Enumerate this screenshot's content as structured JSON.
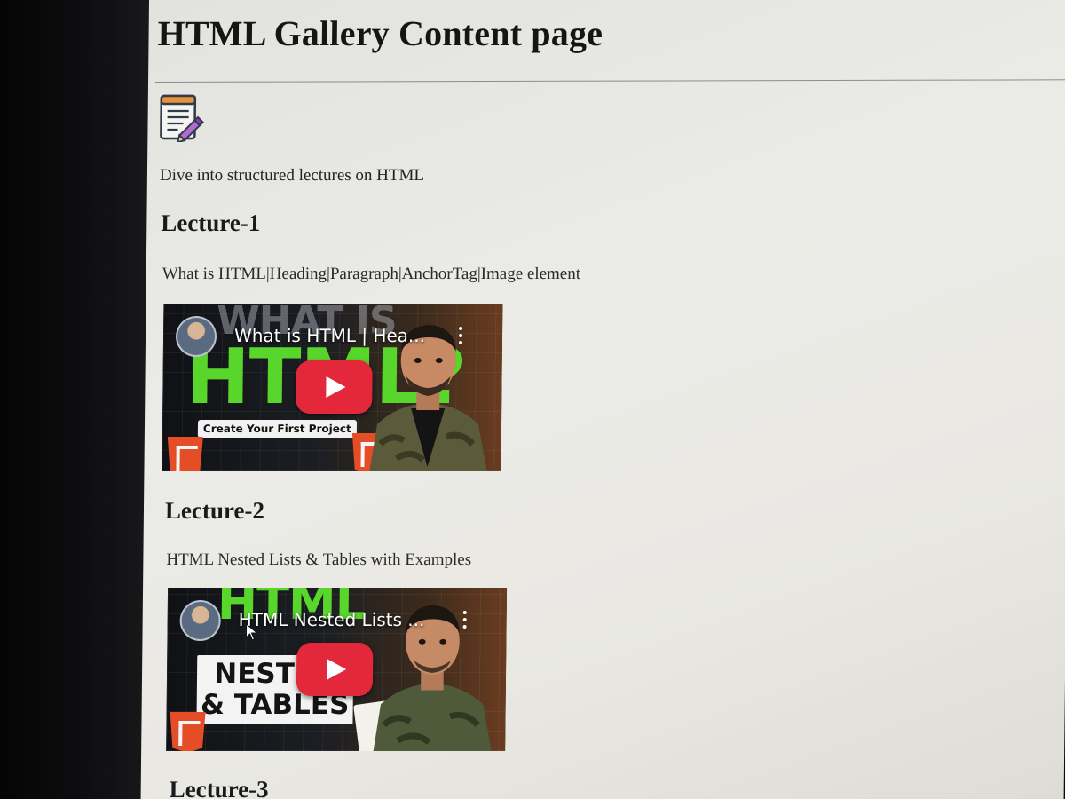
{
  "page": {
    "title": "HTML Gallery Content page",
    "tagline": "Dive into structured lectures on HTML",
    "header_icon": "notepad-pencil-icon"
  },
  "lectures": [
    {
      "heading": "Lecture-1",
      "description": "What is HTML|Heading|Paragraph|AnchorTag|Image element",
      "video": {
        "title": "What is HTML | Hea...",
        "thumbnail_ghost_text": "WHAT IS",
        "thumbnail_big_text": "HTML?",
        "thumbnail_chip": "Create Your First Project",
        "play_icon": "youtube-play-icon",
        "menu_icon": "kebab-menu-icon"
      }
    },
    {
      "heading": "Lecture-2",
      "description": "HTML Nested Lists & Tables with Examples",
      "video": {
        "title": "HTML Nested Lists ...",
        "thumbnail_big_text": "HTML",
        "thumbnail_box_line1": "NESTED",
        "thumbnail_box_line2": "& TABLES",
        "play_icon": "youtube-play-icon",
        "menu_icon": "kebab-menu-icon"
      }
    },
    {
      "heading": "Lecture-3"
    }
  ],
  "colors": {
    "youtube_red": "#e3283c",
    "thumbnail_green": "#59d62c",
    "page_background": "#ebebe7"
  }
}
